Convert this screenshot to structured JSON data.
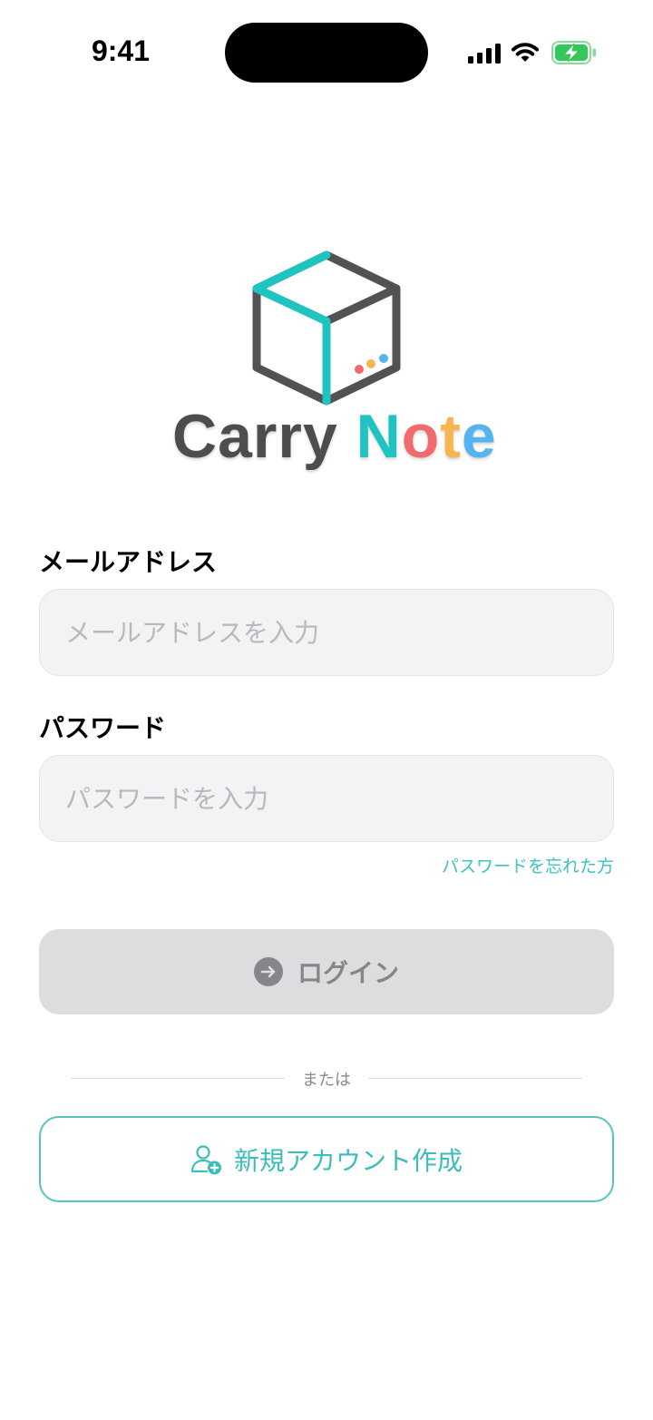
{
  "status_bar": {
    "time": "9:41"
  },
  "logo": {
    "word_carry": "Carry",
    "word_note_letters": [
      "N",
      "o",
      "t",
      "e"
    ]
  },
  "form": {
    "email_label": "メールアドレス",
    "email_placeholder": "メールアドレスを入力",
    "password_label": "パスワード",
    "password_placeholder": "パスワードを入力",
    "forgot_password": "パスワードを忘れた方"
  },
  "actions": {
    "login_label": "ログイン",
    "divider_text": "または",
    "signup_label": "新規アカウント作成"
  },
  "colors": {
    "accent": "#3cc3c0",
    "logo_teal": "#1fc4c0",
    "logo_gray": "#4d4d4f",
    "logo_red": "#f06a6e",
    "logo_orange": "#f7b551",
    "logo_blue": "#54b4f0",
    "battery_green": "#34c759",
    "disabled_button_bg": "#dddde0",
    "disabled_button_text": "#86868a"
  },
  "icons": {
    "login": "arrow-right-circle-icon",
    "signup": "person-add-icon",
    "status": [
      "cellular-signal-icon",
      "wifi-icon",
      "battery-charging-icon"
    ]
  }
}
